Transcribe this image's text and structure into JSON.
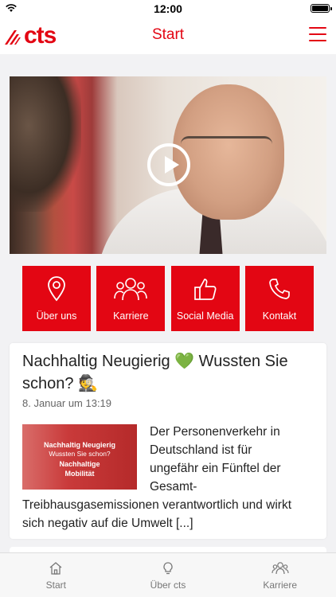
{
  "status": {
    "time": "12:00"
  },
  "header": {
    "logo_text": "cts",
    "title": "Start"
  },
  "tiles": [
    {
      "label": "Über uns",
      "icon": "location-pin-icon"
    },
    {
      "label": "Karriere",
      "icon": "people-group-icon"
    },
    {
      "label": "Social Media",
      "icon": "thumbs-up-icon"
    },
    {
      "label": "Kontakt",
      "icon": "phone-icon"
    }
  ],
  "post": {
    "title": "Nachhaltig Neugierig 💚 Wussten Sie schon? 🕵️",
    "date": "8. Januar um 13:19",
    "thumb": {
      "line1": "Nachhaltig Neugierig",
      "line2": "Wussten Sie schon?",
      "line3": "Nachhaltige",
      "line4": "Mobilität"
    },
    "excerpt": "Der Personenverkehr in Deutschland ist für ungefähr ein Fünftel der Gesamt-Treibhausgasemissionen verantwortlich und wirkt sich negativ auf die Umwelt [...]"
  },
  "tabbar": [
    {
      "label": "Start",
      "icon": "home-icon"
    },
    {
      "label": "Über cts",
      "icon": "lightbulb-icon"
    },
    {
      "label": "Karriere",
      "icon": "people-group-icon"
    }
  ],
  "colors": {
    "brand": "#e30613"
  }
}
